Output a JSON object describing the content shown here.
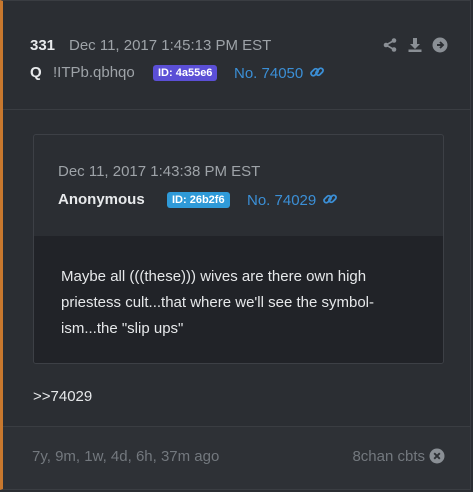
{
  "post": {
    "number": "331",
    "date": "Dec 11, 2017 1:45:13 PM EST",
    "author": "Q",
    "tripcode": "!ITPb.qbhqo",
    "id_badge": "ID: 4a55e6",
    "link": "No. 74050",
    "reply_ref": ">>74029"
  },
  "quoted": {
    "date": "Dec 11, 2017 1:43:38 PM EST",
    "author": "Anonymous",
    "id_badge": "ID: 26b2f6",
    "link": "No. 74029",
    "text": "Maybe all (((these))) wives  are there own high priestess cult...that where we'll see the symbol-ism...the \"slip ups\""
  },
  "footer": {
    "age": "7y, 9m, 1w, 4d, 6h, 37m ago",
    "source": "8chan cbts"
  },
  "icons": [
    "share-icon",
    "download-icon",
    "arrow-right-circle-icon",
    "link-chain-icon",
    "close-circle-icon"
  ],
  "colors": {
    "accent": "#c8782e",
    "link": "#3b8fd6",
    "q_id_badge": "#5b4fd6",
    "anon_id_badge": "#2f9ad8"
  }
}
